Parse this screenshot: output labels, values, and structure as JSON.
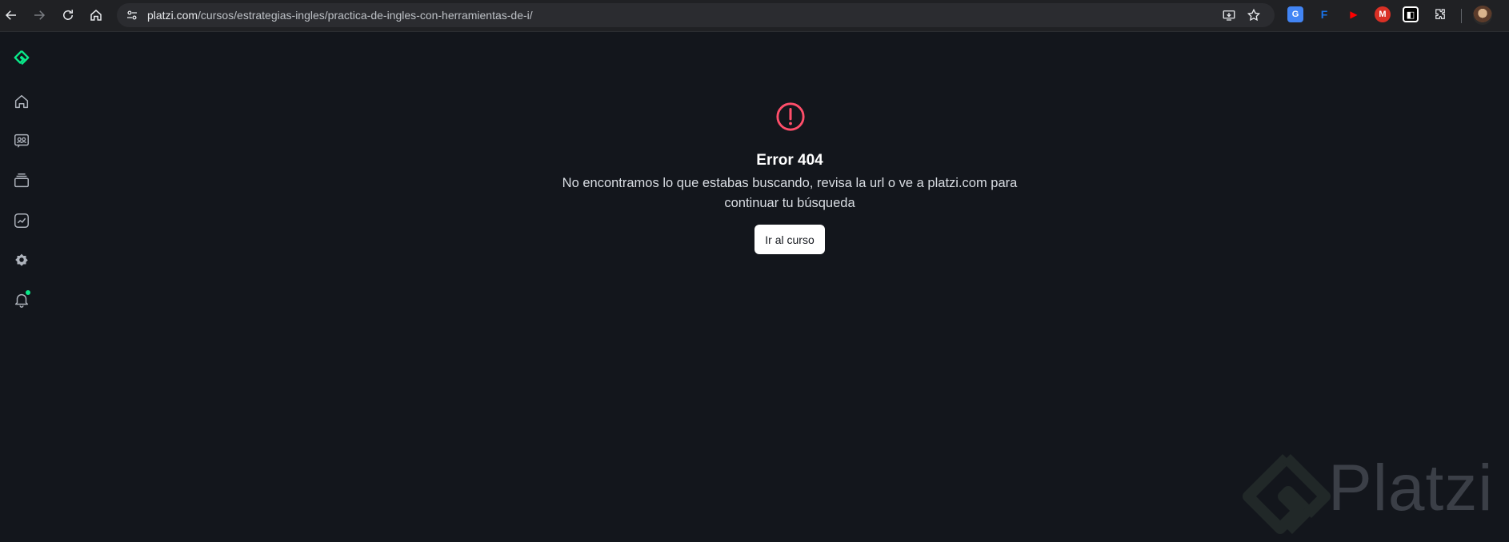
{
  "browser": {
    "url_host": "platzi.com",
    "url_path": "/cursos/estrategias-ingles/practica-de-ingles-con-herramientas-de-i/",
    "nav_icons": [
      "back-icon",
      "forward-icon",
      "reload-icon",
      "home-icon"
    ],
    "omnibox_icons": [
      "site-info-icon",
      "install-app-icon",
      "bookmark-star-icon"
    ],
    "extensions": [
      {
        "name": "google-translate-extension",
        "glyph": "G",
        "color": "#4285f4"
      },
      {
        "name": "f-extension",
        "glyph": "F",
        "color": "#1a73e8"
      },
      {
        "name": "youtube-extension",
        "glyph": "▶",
        "color": "#ff0000"
      },
      {
        "name": "m-extension",
        "glyph": "M",
        "color": "#d93025"
      },
      {
        "name": "dark-extension",
        "glyph": "◧",
        "color": "#ffffff"
      },
      {
        "name": "extensions-puzzle",
        "glyph": "",
        "color": "#bdc1c6"
      }
    ]
  },
  "sidebar": {
    "logo": "platzi-logo-icon",
    "items": [
      {
        "name": "home-icon"
      },
      {
        "name": "community-icon"
      },
      {
        "name": "courses-icon"
      },
      {
        "name": "progress-icon"
      },
      {
        "name": "badges-icon"
      },
      {
        "name": "notifications-bell-icon",
        "has_dot": true
      }
    ]
  },
  "error": {
    "icon": "alert-circle-icon",
    "title": "Error 404",
    "message": "No encontramos lo que estabas buscando, revisa la url o ve a platzi.com para continuar tu búsqueda",
    "button_label": "Ir al curso"
  },
  "watermark": {
    "text": "Platzi"
  },
  "colors": {
    "background": "#13161c",
    "accent": "#0ae98a",
    "error": "#ff4e6a",
    "button_bg": "#ffffff"
  }
}
